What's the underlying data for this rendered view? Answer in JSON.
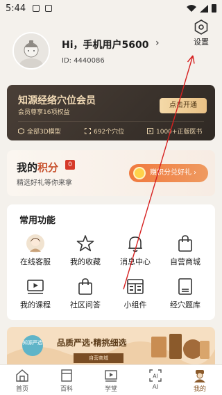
{
  "status_bar": {
    "time": "5:44"
  },
  "profile": {
    "username": "Hi，手机用户5600",
    "chevron": "›",
    "user_id": "ID: 4440086",
    "settings_label": "设置"
  },
  "vip": {
    "title": "知源经络穴位会员",
    "subtitle": "会员尊享16项权益",
    "open_button": "点击开通",
    "features": [
      "全部3D模型",
      "692个穴位",
      "1000+正版医书"
    ]
  },
  "points": {
    "title_prefix": "我的",
    "title_highlight": "积分",
    "badge": "0",
    "subtitle": "精选好礼等你来拿",
    "redeem_button": "赚积分兑好礼 ›"
  },
  "features": {
    "title": "常用功能",
    "items": [
      {
        "label": "在线客服",
        "icon": "customer-service-avatar-icon"
      },
      {
        "label": "我的收藏",
        "icon": "star-icon"
      },
      {
        "label": "消息中心",
        "icon": "bell-icon"
      },
      {
        "label": "自营商城",
        "icon": "shopping-bag-icon"
      },
      {
        "label": "我的课程",
        "icon": "video-icon"
      },
      {
        "label": "社区问答",
        "icon": "shopping-bag-icon"
      },
      {
        "label": "小组件",
        "icon": "widget-icon"
      },
      {
        "label": "经穴题库",
        "icon": "book-icon"
      }
    ]
  },
  "banner": {
    "logo_text": "知源严选",
    "slogan": "品质严选·精挑细选",
    "tag": "自营商城"
  },
  "tabbar": {
    "items": [
      {
        "label": "首页",
        "icon": "home-icon",
        "active": false
      },
      {
        "label": "百科",
        "icon": "encyclopedia-icon",
        "active": false
      },
      {
        "label": "学堂",
        "icon": "classroom-icon",
        "active": false
      },
      {
        "label": "AI",
        "icon": "ai-scan-icon",
        "active": false
      },
      {
        "label": "我的",
        "icon": "profile-doctor-icon",
        "active": true
      }
    ]
  },
  "colors": {
    "background": "#f4f1ec",
    "vip_card": "#3d342d",
    "vip_gold": "#f0d9b5",
    "points_accent": "#c7502c",
    "redeem_orange": "#f07a3f",
    "annotation_red": "#d62020",
    "tab_active": "#8b5a2b"
  }
}
